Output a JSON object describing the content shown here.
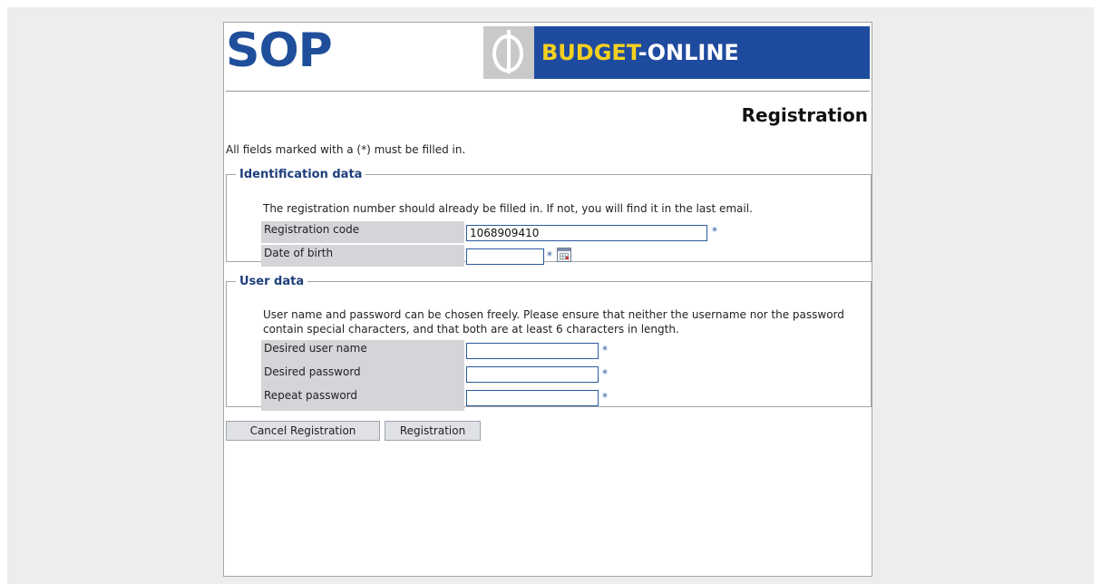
{
  "header": {
    "logo_text": "SOP",
    "banner_part1": "BUDGET",
    "banner_part2": "-ONLINE"
  },
  "page_title": "Registration",
  "required_note": "All fields marked with a (*) must be filled in.",
  "identification": {
    "legend": "Identification data",
    "hint": "The registration number should already be filled in. If not, you will find it in the last email.",
    "registration_code_label": "Registration code",
    "registration_code_value": "1068909410",
    "date_of_birth_label": "Date of birth",
    "date_of_birth_value": "",
    "required_mark": "*"
  },
  "user_data": {
    "legend": "User data",
    "hint": "User name and password can be chosen freely. Please ensure that neither the username nor the password contain special characters, and that both are at least 6 characters in length.",
    "username_label": "Desired user name",
    "password_label": "Desired password",
    "repeat_password_label": "Repeat password",
    "required_mark": "*"
  },
  "buttons": {
    "cancel_label": "Cancel Registration",
    "submit_label": "Registration"
  },
  "colors": {
    "brand_blue": "#1f4b9e",
    "brand_yellow": "#f5d020",
    "label_bg": "#d3d5d8"
  },
  "icons": [
    "phi-logo-icon",
    "calendar-icon"
  ]
}
